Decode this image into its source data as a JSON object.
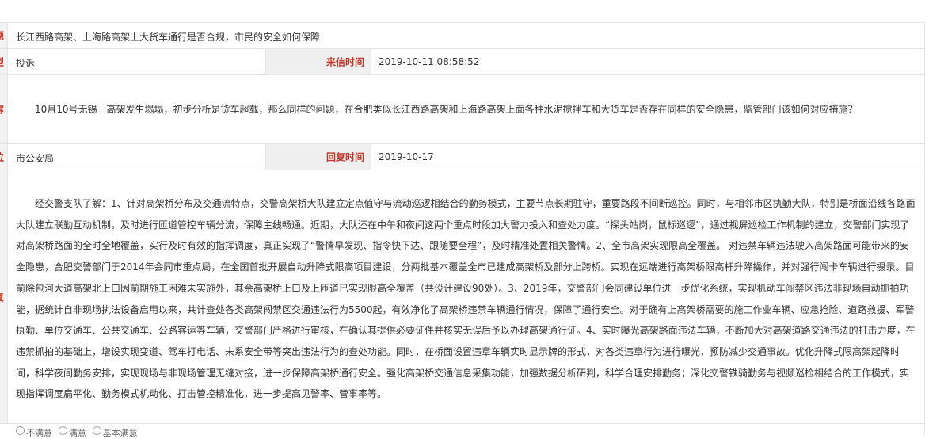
{
  "rows": {
    "title": {
      "label": "标题",
      "value": "长江西路高架、上海路高架上大货车通行是否合规，市民的安全如何保障"
    },
    "type": {
      "label": "类型",
      "value": "投诉",
      "time_label": "来信时间",
      "time_value": "2019-10-11 08:58:52"
    },
    "content": {
      "label": "内容",
      "value": "10月10号无锡一高架发生塌塌，初步分析是货车超载，那么同样的问题，在合肥类似长江西路高架和上海路高架上面各种水泥搅拌车和大货车是否存在同样的安全隐患，监管部门该如何对应措施？"
    },
    "unit": {
      "label": "单位",
      "value": "市公安局",
      "time_label": "回复时间",
      "time_value": "2019-10-17"
    },
    "reply": {
      "label": "回复",
      "value": "经交警支队了解：1、针对高架桥分布及交通流特点，交警高架桥大队建立定点值守与流动巡逻相结合的勤务模式，主要节点长期驻守，重要路段不间断巡控。同时，与相邻市区执勤大队，特别是桥面沿线各路面大队建立联勤互动机制，及时进行匝道管控车辆分流，保障主线畅通。近期，大队还在中午和夜间这两个重点时段加大警力投入和查处力度。“探头站岗，鼠标巡逻”，通过视屏巡检工作机制的建立，交警部门实现了对高架桥路面的全时全地覆盖，实行及时有效的指挥调度，真正实现了“警情早发现、指令快下达、跟随要全程”，及时精准处置相关警情。2、全市高架实现限高全覆盖。 对违禁车辆违法驶入高架路面可能带来的安全隐患，合肥交警部门于2014年会同市重点局，在全国首批开展自动升降式限高项目建设，分两批基本覆盖全市已建成高架桥及部分上跨桥。实现在远端进行高架桥限高杆升降操作，并对强行闯卡车辆进行摄录。目前除包河大道高架北上口因前期施工困难未实施外，其余高架桥上口及上匝道已实现限高全覆盖（共设计建设90处）。3、2019年，交警部门会同建设单位进一步优化系统，实现机动车闯禁区违法非现场自动抓拍功能，据统计自非现场执法设备启用以来，共计查处各类高架闯禁区交通违法行为5500起，有效净化了高架桥违禁车辆通行情况，保障了通行安全。对于确有上高架桥需要的施工作业车辆、应急抢险、道路救援、军警执勤、单位交通车、公共交通车、公路客运等车辆，交警部门严格进行审核，在确认其提供必要证件并核实无误后予以办理高架通行证。4、实时曝光高架路面违法车辆，不断加大对高架道路交通违法的打击力度，在违禁抓拍的基础上，增设实现变道、驾车打电话、未系安全带等突出违法行为的查处功能。同时，在桥面设置违章车辆实时显示牌的形式，对各类违章行为进行曝光，预防减少交通事故。优化升降式限高架起降时间，科学夜间勤务安排，实现现场与非现场管理无缝对接，进一步保障高架桥通行安全。强化高架桥交通信息采集功能，加强数据分析研判，科学合理安排勤务；深化交警铁骑勤务与视频巡检相结合的工作模式，实现指挥调度扁平化、勤务模式机动化、打击管控精准化，进一步提高见警率、管事率等。"
    }
  },
  "rating": {
    "options": [
      "不满意",
      "满意",
      "基本满意"
    ]
  }
}
